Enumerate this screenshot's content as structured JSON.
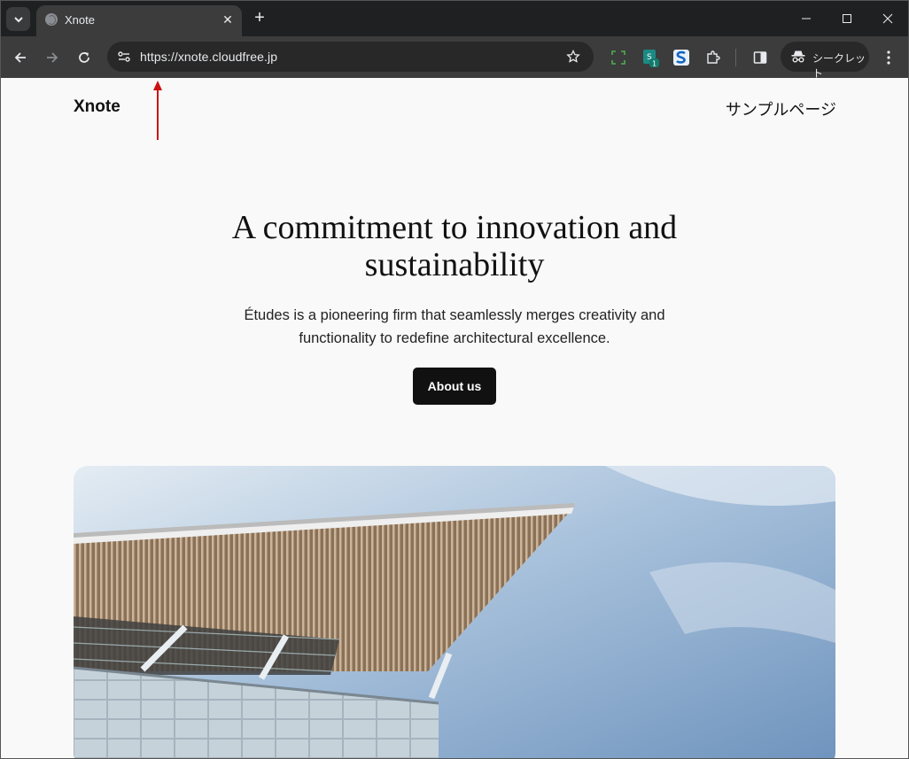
{
  "browser": {
    "tab": {
      "title": "Xnote"
    },
    "url": "https://xnote.cloudfree.jp",
    "incognito_label": "シークレット",
    "extension_badge": "1",
    "icons": [
      "tab-search-icon",
      "globe-icon",
      "close-icon",
      "plus-icon",
      "minimize-icon",
      "maximize-icon",
      "back-icon",
      "forward-icon",
      "reload-icon",
      "site-info-icon",
      "star-icon",
      "capture-icon",
      "extension-icon",
      "s-extension-icon",
      "puzzle-icon",
      "side-panel-icon",
      "incognito-icon",
      "kebab-menu-icon"
    ]
  },
  "page": {
    "site_title": "Xnote",
    "nav_link": "サンプルページ",
    "hero": {
      "heading_lines": [
        "A commitment to innovation and",
        "sustainability"
      ],
      "description_lines": [
        "Études is a pioneering firm that seamlessly merges creativity and",
        "functionality to redefine architectural excellence."
      ],
      "button_label": "About us"
    }
  },
  "annotation": {
    "arrow_color": "#cc1111"
  },
  "colors": {
    "chrome_dark": "#1f2021",
    "chrome_toolbar": "#3c3c3c",
    "page_bg": "#f9f9f9",
    "button_bg": "#111111"
  }
}
